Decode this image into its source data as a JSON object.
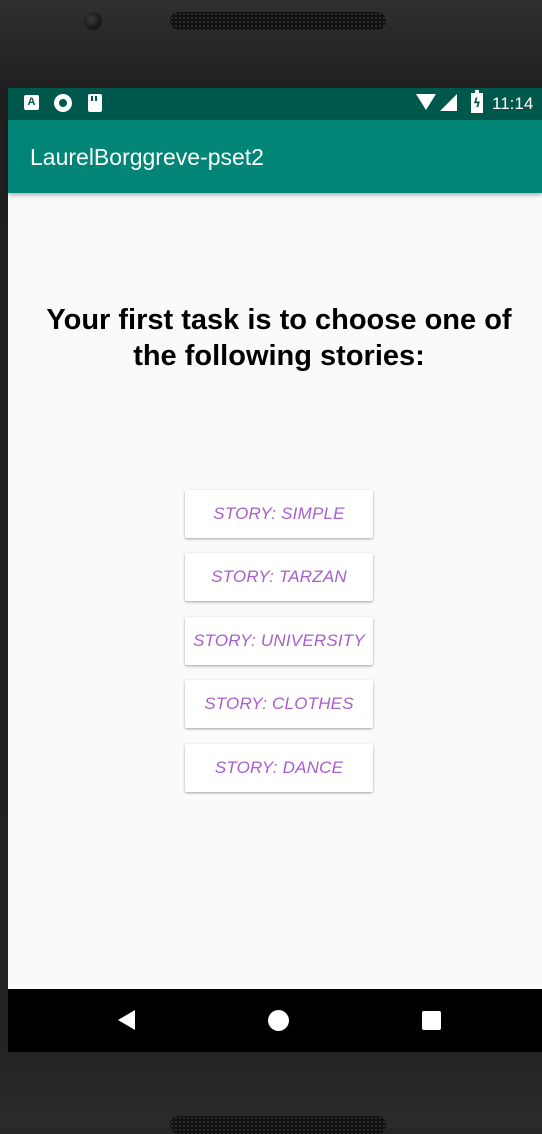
{
  "status_bar": {
    "time": "11:14",
    "icons": [
      "a-notification-icon",
      "circle-notification-icon",
      "sd-card-icon",
      "wifi-icon",
      "cell-signal-icon",
      "battery-charging-icon"
    ],
    "notification_letter": "A"
  },
  "app_bar": {
    "title": "LaurelBorggreve-pset2"
  },
  "main": {
    "heading": "Your first task is to choose one of the following stories:",
    "stories": [
      {
        "label": "STORY: SIMPLE"
      },
      {
        "label": "STORY: TARZAN"
      },
      {
        "label": "STORY: UNIVERSITY"
      },
      {
        "label": "STORY: CLOTHES"
      },
      {
        "label": "STORY: DANCE"
      }
    ]
  },
  "colors": {
    "status_bar": "#00574b",
    "app_bar": "#008577",
    "button_text": "#a65fcc",
    "background": "#fafafa"
  },
  "nav_bar": {
    "icons": [
      "back-icon",
      "home-icon",
      "recents-icon"
    ]
  }
}
